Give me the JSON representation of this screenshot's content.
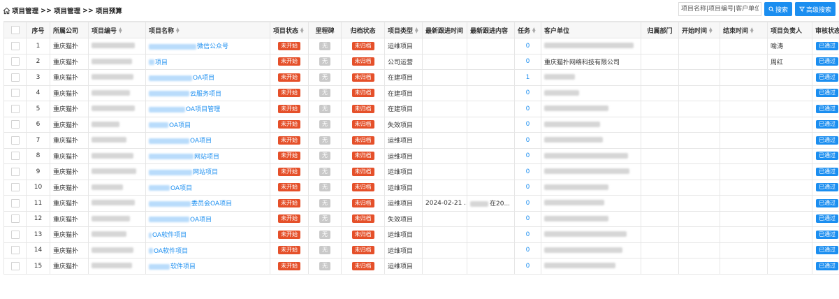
{
  "breadcrumb": {
    "items": [
      "项目管理",
      "项目管理",
      "项目预算"
    ],
    "separator": ">>"
  },
  "search": {
    "placeholder": "项目名称|项目编号|客户单位",
    "value": "",
    "search_label": "搜索",
    "advanced_label": "高级搜索"
  },
  "table": {
    "columns": {
      "seq": "序号",
      "company": "所属公司",
      "code": "项目编号",
      "name": "项目名称",
      "status": "项目状态",
      "milestone": "里程碑",
      "archive": "归档状态",
      "type": "项目类型",
      "follow_time": "最新跟进时间",
      "follow_content": "最新跟进内容",
      "task": "任务",
      "client": "客户单位",
      "dept": "归属部门",
      "start": "开始时间",
      "end": "结束时间",
      "owner": "项目负责人",
      "audit": "审核状态"
    },
    "rows": [
      {
        "seq": "1",
        "company": "重庆猫扑",
        "name": "微信公众号",
        "status": "未开始",
        "milestone": "无",
        "archive": "未归档",
        "type": "运维项目",
        "follow_time": "",
        "follow_content": "",
        "task": "0",
        "client": "",
        "owner": "喻涛",
        "audit": "已通过"
      },
      {
        "seq": "2",
        "company": "重庆猫扑",
        "name": "项目",
        "status": "未开始",
        "milestone": "无",
        "archive": "未归档",
        "type": "公司运营",
        "follow_time": "",
        "follow_content": "",
        "task": "0",
        "client": "重庆猫扑网络科技有限公司",
        "owner": "周红",
        "audit": "已通过"
      },
      {
        "seq": "3",
        "company": "重庆猫扑",
        "name": "OA项目",
        "status": "未开始",
        "milestone": "无",
        "archive": "未归档",
        "type": "在建项目",
        "follow_time": "",
        "follow_content": "",
        "task": "1",
        "client": "",
        "owner": "",
        "audit": "已通过"
      },
      {
        "seq": "4",
        "company": "重庆猫扑",
        "name": "云服务项目",
        "status": "未开始",
        "milestone": "无",
        "archive": "未归档",
        "type": "在建项目",
        "follow_time": "",
        "follow_content": "",
        "task": "0",
        "client": "",
        "owner": "",
        "audit": "已通过"
      },
      {
        "seq": "5",
        "company": "重庆猫扑",
        "name": "OA项目管理",
        "status": "未开始",
        "milestone": "无",
        "archive": "未归档",
        "type": "在建项目",
        "follow_time": "",
        "follow_content": "",
        "task": "0",
        "client": "",
        "owner": "",
        "audit": "已通过"
      },
      {
        "seq": "6",
        "company": "重庆猫扑",
        "name": "OA项目",
        "status": "未开始",
        "milestone": "无",
        "archive": "未归档",
        "type": "失效项目",
        "follow_time": "",
        "follow_content": "",
        "task": "0",
        "client": "",
        "owner": "",
        "audit": "已通过"
      },
      {
        "seq": "7",
        "company": "重庆猫扑",
        "name": "OA项目",
        "status": "未开始",
        "milestone": "无",
        "archive": "未归档",
        "type": "运维项目",
        "follow_time": "",
        "follow_content": "",
        "task": "0",
        "client": "",
        "owner": "",
        "audit": "已通过"
      },
      {
        "seq": "8",
        "company": "重庆猫扑",
        "name": "网站项目",
        "status": "未开始",
        "milestone": "无",
        "archive": "未归档",
        "type": "运维项目",
        "follow_time": "",
        "follow_content": "",
        "task": "0",
        "client": "",
        "owner": "",
        "audit": "已通过"
      },
      {
        "seq": "9",
        "company": "重庆猫扑",
        "name": "网站项目",
        "status": "未开始",
        "milestone": "无",
        "archive": "未归档",
        "type": "运维项目",
        "follow_time": "",
        "follow_content": "",
        "task": "0",
        "client": "",
        "owner": "",
        "audit": "已通过"
      },
      {
        "seq": "10",
        "company": "重庆猫扑",
        "name": "OA项目",
        "status": "未开始",
        "milestone": "无",
        "archive": "未归档",
        "type": "运维项目",
        "follow_time": "",
        "follow_content": "",
        "task": "0",
        "client": "",
        "owner": "",
        "audit": "已通过"
      },
      {
        "seq": "11",
        "company": "重庆猫扑",
        "name": "委员会OA项目",
        "status": "未开始",
        "milestone": "无",
        "archive": "未归档",
        "type": "运维项目",
        "follow_time": "2024-02-21 ...",
        "follow_content": "在20...",
        "task": "0",
        "client": "",
        "owner": "",
        "audit": "已通过"
      },
      {
        "seq": "12",
        "company": "重庆猫扑",
        "name": "OA项目",
        "status": "未开始",
        "milestone": "无",
        "archive": "未归档",
        "type": "失效项目",
        "follow_time": "",
        "follow_content": "",
        "task": "0",
        "client": "",
        "owner": "",
        "audit": "已通过"
      },
      {
        "seq": "13",
        "company": "重庆猫扑",
        "name": "OA软件项目",
        "status": "未开始",
        "milestone": "无",
        "archive": "未归档",
        "type": "运维项目",
        "follow_time": "",
        "follow_content": "",
        "task": "0",
        "client": "",
        "owner": "",
        "audit": "已通过"
      },
      {
        "seq": "14",
        "company": "重庆猫扑",
        "name": "OA软件项目",
        "status": "未开始",
        "milestone": "无",
        "archive": "未归档",
        "type": "运维项目",
        "follow_time": "",
        "follow_content": "",
        "task": "0",
        "client": "",
        "owner": "",
        "audit": "已通过"
      },
      {
        "seq": "15",
        "company": "重庆猫扑",
        "name": "软件项目",
        "status": "未开始",
        "milestone": "无",
        "archive": "未归档",
        "type": "运维项目",
        "follow_time": "",
        "follow_content": "",
        "task": "0",
        "client": "",
        "owner": "",
        "audit": "已通过"
      }
    ]
  },
  "colors": {
    "accent": "#1b8ef0",
    "status_red": "#e5502a",
    "milestone_gray": "#c9c9c9"
  },
  "icons": {
    "home": "home-icon",
    "search": "search-icon",
    "filter": "filter-icon",
    "sort": "sort-icon"
  }
}
